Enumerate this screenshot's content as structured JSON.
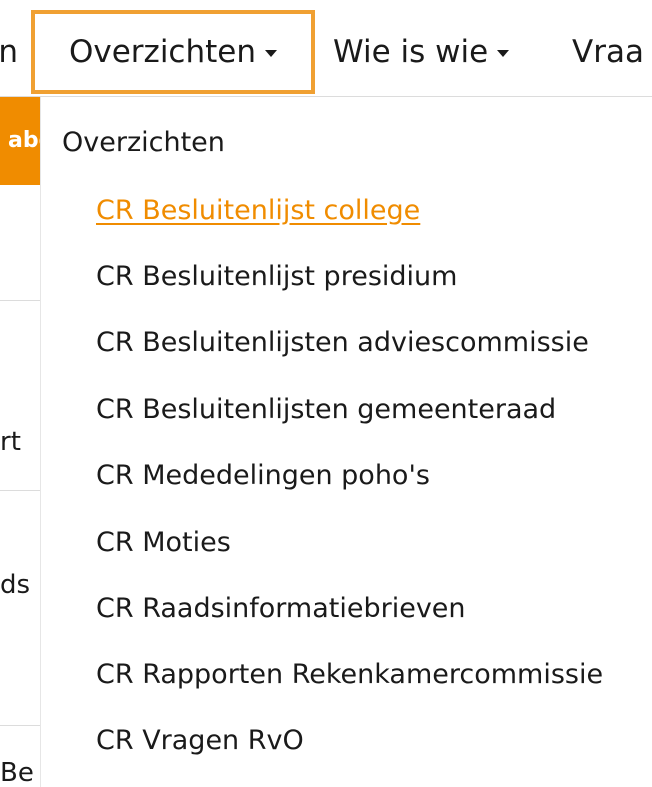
{
  "navbar": {
    "left_cut_label": "n",
    "items": [
      {
        "label": "Overzichten",
        "active": true
      },
      {
        "label": "Wie is wie"
      },
      {
        "label": "Vraa"
      }
    ]
  },
  "background": {
    "orange_label": "abo",
    "texts": [
      "rt",
      "ds",
      "Be"
    ]
  },
  "dropdown": {
    "header": "Overzichten",
    "items": [
      {
        "label": "CR Besluitenlijst college",
        "hover": true
      },
      {
        "label": "CR Besluitenlijst presidium"
      },
      {
        "label": "CR Besluitenlijsten adviescommissie"
      },
      {
        "label": "CR Besluitenlijsten gemeenteraad"
      },
      {
        "label": "CR Mededelingen poho's"
      },
      {
        "label": "CR Moties"
      },
      {
        "label": "CR Raadsinformatiebrieven"
      },
      {
        "label": "CR Rapporten Rekenkamercommissie"
      },
      {
        "label": "CR Vragen RvO"
      }
    ]
  },
  "colors": {
    "accent": "#f08c00",
    "active_border": "#f0a032"
  },
  "icons": [
    "caret-down-icon"
  ]
}
